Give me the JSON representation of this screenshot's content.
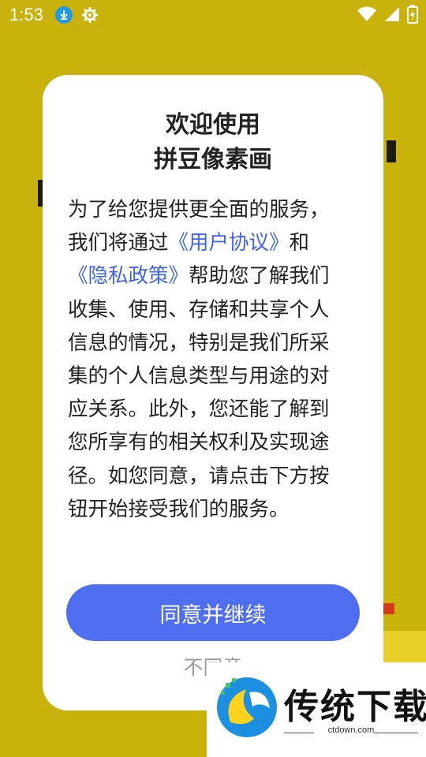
{
  "status_bar": {
    "time": "1:53",
    "icons_left": [
      "download-icon",
      "settings-icon"
    ],
    "icons_right": [
      "wifi-icon",
      "signal-icon",
      "battery-charging-icon"
    ]
  },
  "dialog": {
    "title_line1": "欢迎使用",
    "title_line2": "拼豆像素画",
    "body": {
      "part1": "为了给您提供更全面的服务，我们将通过",
      "link_user_agreement": "《用户协议》",
      "part2": "和",
      "link_privacy_policy": "《隐私政策》",
      "part3": "帮助您了解我们收集、使用、存储和共享个人信息的情况，特别是我们所采集的个人信息类型与用途的对应关系。此外，您还能了解到您所享有的相关权利及实现途径。如您同意，请点击下方按钮开始接受我们的服务。"
    },
    "agree_button": "同意并继续",
    "disagree_link": "不同意"
  },
  "watermark": {
    "brand": "传统下载",
    "url": "ctdown.com"
  },
  "colors": {
    "background": "#c9b20b",
    "accent": "#4f6ff0",
    "link": "#3f63e8"
  }
}
